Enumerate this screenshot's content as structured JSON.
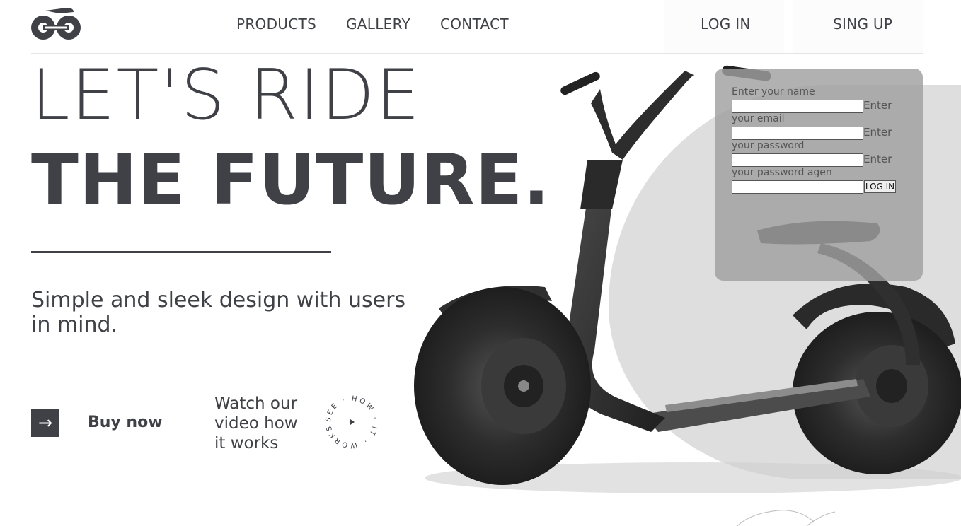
{
  "header": {
    "nav": [
      "PRODUCTS",
      "GALLERY",
      "CONTACT"
    ],
    "login": "LOG IN",
    "signup": "SING UP"
  },
  "hero": {
    "line1": "LET'S RIDE",
    "line2": "THE FUTURE.",
    "tagline": "Simple and sleek design with users in mind."
  },
  "cta": {
    "buy_arrow": "→",
    "buy_label": "Buy now",
    "watch_text": "Watch our video how it works",
    "badge_text": "SEE · HOW · IT · WORKS ·"
  },
  "login_panel": {
    "name_label": "Enter your name",
    "email_label": "your email",
    "password_label": "your password",
    "password_again_label": "your password agen",
    "enter_label": "Enter",
    "submit_label": "LOG IN",
    "name_value": "",
    "email_value": "",
    "password_value": "",
    "password_again_value": ""
  },
  "colors": {
    "text": "#3f4147",
    "panel": "#a0a0a0",
    "blob": "#dedede"
  }
}
